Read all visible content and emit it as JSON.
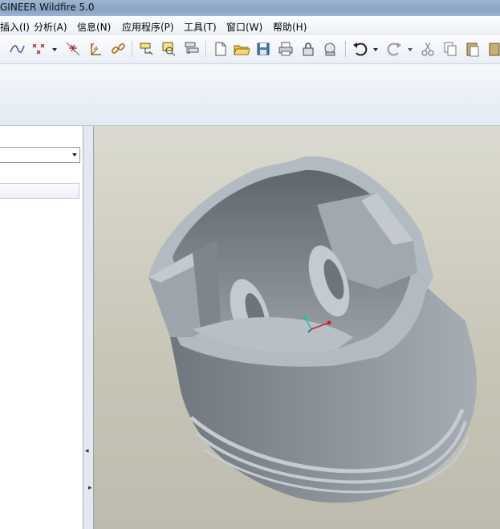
{
  "window": {
    "title": "GINEER Wildfire 5.0"
  },
  "menu": [
    "插入(I)",
    "分析(A)",
    "信息(N)",
    "应用程序(P)",
    "工具(T)",
    "窗口(W)",
    "帮助(H)"
  ],
  "toolbar": {
    "icons": [
      "sketch-curve-icon",
      "datum-point-icon",
      "dropdown-arrow-icon",
      "datum-axis-icon",
      "coordinate-system-icon",
      "link-icon",
      "layer-tree-icon",
      "model-tree-icon",
      "settings-tree-icon",
      "new-file-icon",
      "open-folder-icon",
      "save-icon",
      "print-icon",
      "lock-icon",
      "record-icon",
      "undo-icon",
      "redo-icon",
      "cut-icon",
      "copy-icon",
      "paste-icon"
    ]
  },
  "colors": {
    "viewport_bg": "#cfcdbf",
    "model_gray": "#8e959c",
    "menu_bg": "#f4f7fb"
  },
  "viewport": {
    "model": "piston-3d-model"
  }
}
